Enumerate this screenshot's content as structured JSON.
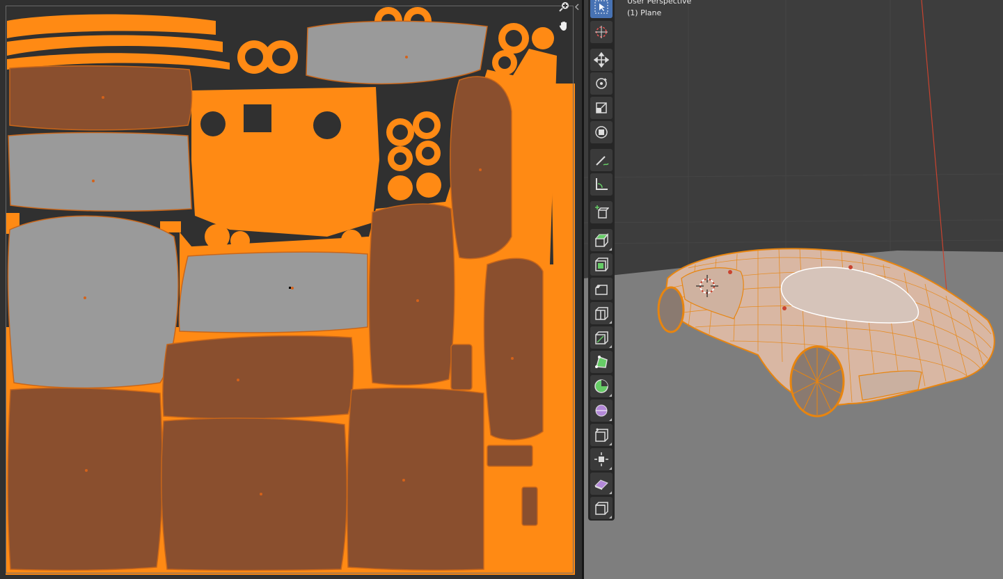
{
  "viewport": {
    "view_name": "User Perspective",
    "object_name": "(1) Plane"
  },
  "colors": {
    "uv_background": "#303030",
    "uv_island_selected": "#ff8a14",
    "uv_face_brown": "#8a4f2e",
    "uv_face_grey": "#9a9a9a",
    "viewport_background": "#3d3d3d",
    "floor": "#808080",
    "wire": "#e8850f",
    "active_tool": "#4772b3"
  },
  "uv_editor": {
    "header_icons": [
      "zoom-icon",
      "hand-pan-icon"
    ]
  },
  "toolbar": {
    "tools": [
      {
        "name": "select-box-icon",
        "active": true
      },
      {
        "name": "cursor-icon",
        "active": false
      },
      {
        "name": "move-icon",
        "active": false
      },
      {
        "name": "rotate-icon",
        "active": false
      },
      {
        "name": "scale-icon",
        "active": false
      },
      {
        "name": "transform-icon",
        "active": false
      },
      {
        "name": "annotate-icon",
        "active": false
      },
      {
        "name": "measure-icon",
        "active": false
      },
      {
        "name": "add-cube-icon",
        "active": false
      },
      {
        "name": "extrude-region-icon",
        "active": false
      },
      {
        "name": "inset-faces-icon",
        "active": false
      },
      {
        "name": "bevel-icon",
        "active": false
      },
      {
        "name": "loop-cut-icon",
        "active": false
      },
      {
        "name": "knife-icon",
        "active": false
      },
      {
        "name": "poly-build-icon",
        "active": false
      },
      {
        "name": "spin-icon",
        "active": false
      },
      {
        "name": "smooth-icon",
        "active": false
      },
      {
        "name": "edge-slide-icon",
        "active": false
      },
      {
        "name": "shrink-fatten-icon",
        "active": false
      },
      {
        "name": "shear-icon",
        "active": false
      },
      {
        "name": "rip-region-icon",
        "active": false
      }
    ]
  }
}
